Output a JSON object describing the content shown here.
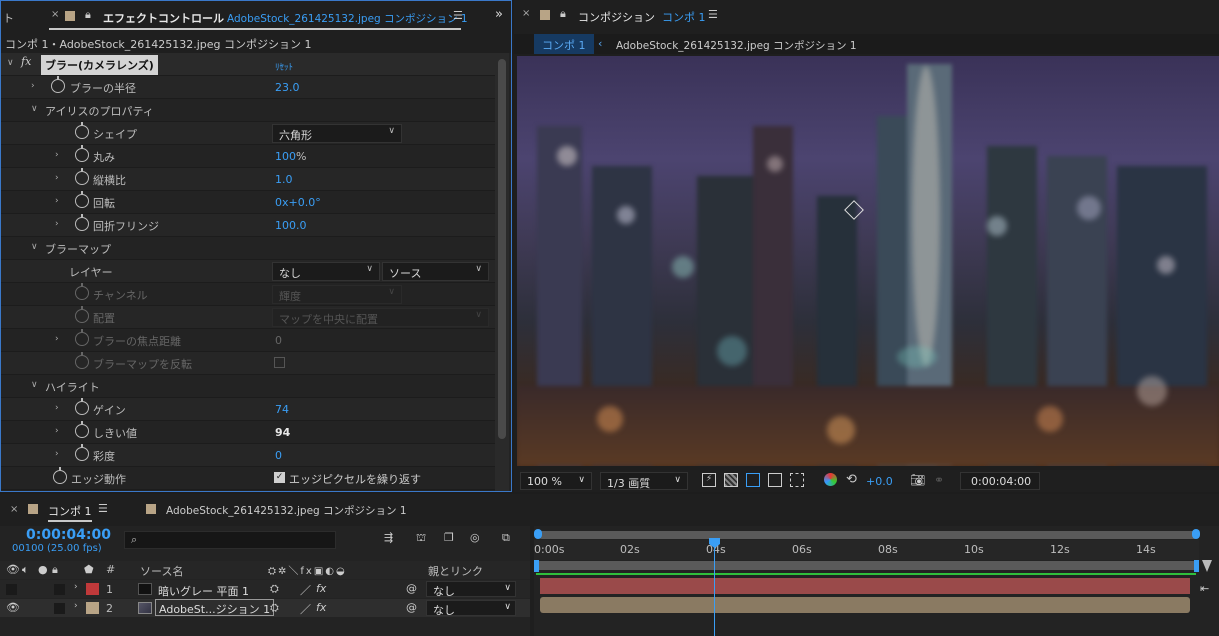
{
  "effect_controls": {
    "left_stub": "ト",
    "tab_title": "エフェクトコントロール",
    "tab_file": "AdobeStock_261425132.jpeg コンポジション 1",
    "header": "コンポ 1・AdobeStock_261425132.jpeg コンポジション 1",
    "effect_name": "ブラー(カメラレンズ)",
    "fx_label": "fx",
    "reset_label": "ﾘｾｯﾄ",
    "blur_radius_label": "ブラーの半径",
    "blur_radius_value": "23.0",
    "iris_label": "アイリスのプロパティ",
    "shape_label": "シェイプ",
    "shape_value": "六角形",
    "roundness_label": "丸み",
    "roundness_value": "100",
    "roundness_unit": "%",
    "aspect_label": "縦横比",
    "aspect_value": "1.0",
    "rotation_label": "回転",
    "rotation_value": "0x+0.0",
    "rotation_unit": "°",
    "fringe_label": "回折フリンジ",
    "fringe_value": "100.0",
    "blurmap_label": "ブラーマップ",
    "layer_label": "レイヤー",
    "layer_value": "なし",
    "source_value": "ソース",
    "channel_label": "チャンネル",
    "channel_value": "輝度",
    "placement_label": "配置",
    "placement_value": "マップを中央に配置",
    "focal_label": "ブラーの焦点距離",
    "focal_value": "0",
    "invert_label": "ブラーマップを反転",
    "highlight_label": "ハイライト",
    "gain_label": "ゲイン",
    "gain_value": "74",
    "threshold_label": "しきい値",
    "threshold_value": "94",
    "saturation_label": "彩度",
    "saturation_value": "0",
    "edge_label": "エッジ動作",
    "edge_checkbox_label": "エッジピクセルを繰り返す"
  },
  "composition": {
    "tab_title": "コンポジション",
    "tab_comp": "コンポ 1",
    "sub_comp": "コンポ 1",
    "sub_file": "AdobeStock_261425132.jpeg コンポジション 1",
    "zoom": "100 %",
    "resolution": "1/3 画質",
    "exposure": "+0.0",
    "timecode": "0:00:04:00"
  },
  "timeline": {
    "tab_comp": "コンポ 1",
    "tab_file": "AdobeStock_261425132.jpeg コンポジション 1",
    "current_time": "0:00:04:00",
    "frame_info": "00100 (25.00 fps)",
    "search_placeholder": "",
    "col_number": "#",
    "col_source": "ソース名",
    "col_parent": "親とリンク",
    "ruler": [
      "0:00s",
      "02s",
      "04s",
      "06s",
      "08s",
      "10s",
      "12s",
      "14s"
    ],
    "layers": [
      {
        "num": "1",
        "name": "暗いグレー 平面 1",
        "parent": "なし",
        "label_color": "#c0393a"
      },
      {
        "num": "2",
        "name": "AdobeSt...ジション 1",
        "parent": "なし",
        "label_color": "#b8a486"
      }
    ]
  },
  "colors": {
    "accent_blue": "#3a9ef5",
    "layer1_bar": "#9a4a4a",
    "layer2_bar": "#8a7a62",
    "work_area_green": "#2fbf3c"
  }
}
